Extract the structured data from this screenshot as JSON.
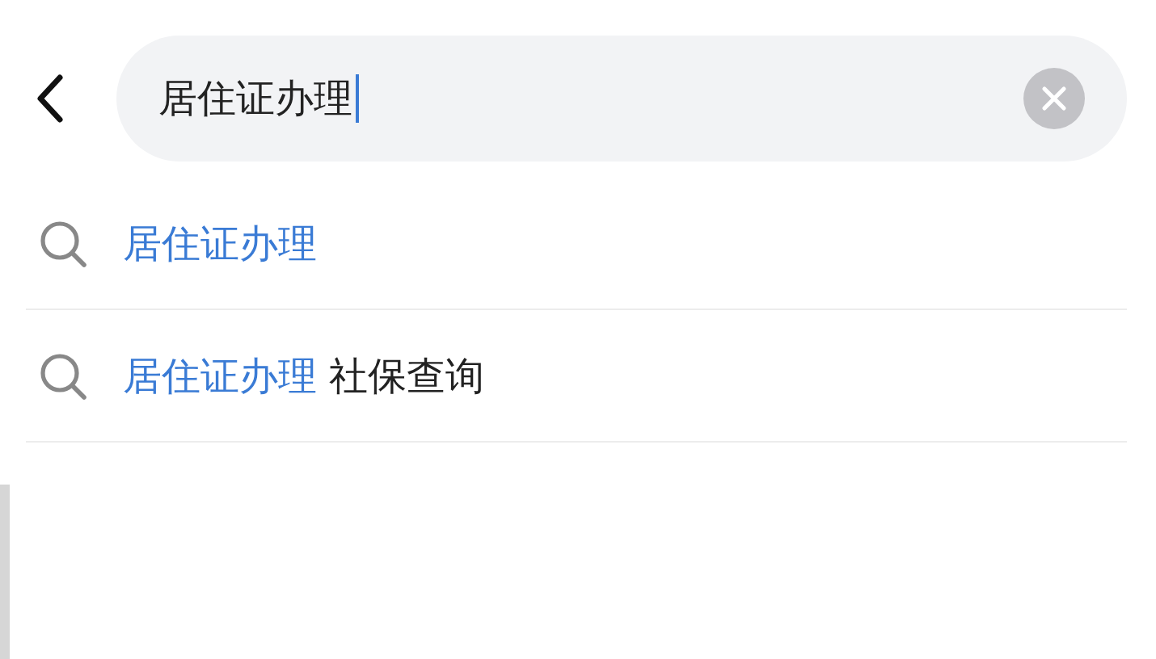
{
  "search": {
    "value": "居住证办理"
  },
  "suggestions": [
    {
      "match": "居住证办理"
    },
    {
      "match": "居住证办理",
      "rest": "社保查询"
    }
  ]
}
